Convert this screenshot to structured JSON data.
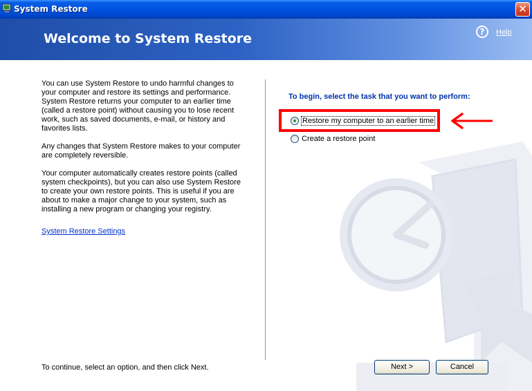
{
  "window": {
    "title": "System Restore",
    "close_glyph": "✕"
  },
  "header": {
    "title": "Welcome to System Restore",
    "help_link": "Help",
    "help_icon_glyph": "?"
  },
  "intro": {
    "paragraphs": [
      "You can use System Restore to undo harmful changes to your computer and restore its settings and performance. System Restore returns your computer to an earlier time (called a restore point) without causing you to lose recent work, such as saved documents, e-mail, or history and favorites lists.",
      "Any changes that System Restore makes to your computer are completely reversible.",
      "Your computer automatically creates restore points (called system checkpoints), but you can also use System Restore to create your own restore points. This is useful if you are about to make a major change to your system, such as installing a new program or changing your registry."
    ],
    "settings_link": "System Restore Settings"
  },
  "tasks": {
    "heading": "To begin, select the task that you want to perform:",
    "options": [
      {
        "label": "Restore my computer to an earlier time",
        "checked": true
      },
      {
        "label": "Create a restore point",
        "checked": false
      }
    ]
  },
  "footer": {
    "instruction": "To continue, select an option, and then click Next.",
    "next_label": "Next >",
    "cancel_label": "Cancel"
  },
  "colors": {
    "annotation": "#ff0000",
    "heading_blue": "#0033aa"
  }
}
